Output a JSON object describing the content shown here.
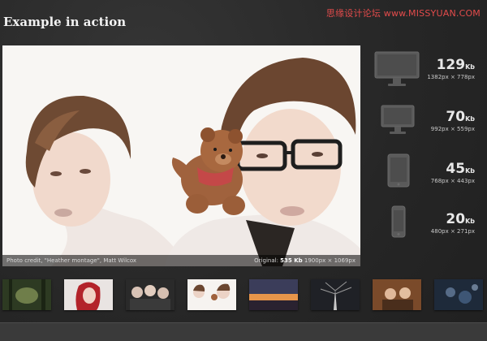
{
  "watermark": "思缘设计论坛 www.MISSYUAN.COM",
  "section_title": "Example in action",
  "hero": {
    "photo_credit": "Photo credit, \"Heather montage\", Matt Wilcox",
    "original_label": "Original:",
    "original_size": "535 Kb",
    "original_dims": "1900px × 1069px"
  },
  "devices": [
    {
      "icon": "desktop-monitor-icon",
      "size": "129",
      "unit": "Kb",
      "dims": "1382px × 778px"
    },
    {
      "icon": "laptop-monitor-icon",
      "size": "70",
      "unit": "Kb",
      "dims": "992px × 559px"
    },
    {
      "icon": "tablet-icon",
      "size": "45",
      "unit": "Kb",
      "dims": "768px × 443px"
    },
    {
      "icon": "phone-icon",
      "size": "20",
      "unit": "Kb",
      "dims": "480px × 271px"
    }
  ],
  "thumbnails": [
    {
      "name": "forest-thumbnail"
    },
    {
      "name": "red-hair-woman-thumbnail"
    },
    {
      "name": "group-portrait-thumbnail"
    },
    {
      "name": "heather-montage-thumbnail"
    },
    {
      "name": "sunset-thumbnail"
    },
    {
      "name": "dark-tree-thumbnail"
    },
    {
      "name": "couple-thumbnail"
    },
    {
      "name": "bokeh-thumbnail"
    }
  ],
  "colors": {
    "accent": "#e34b4b",
    "background": "#2b2b2b"
  }
}
